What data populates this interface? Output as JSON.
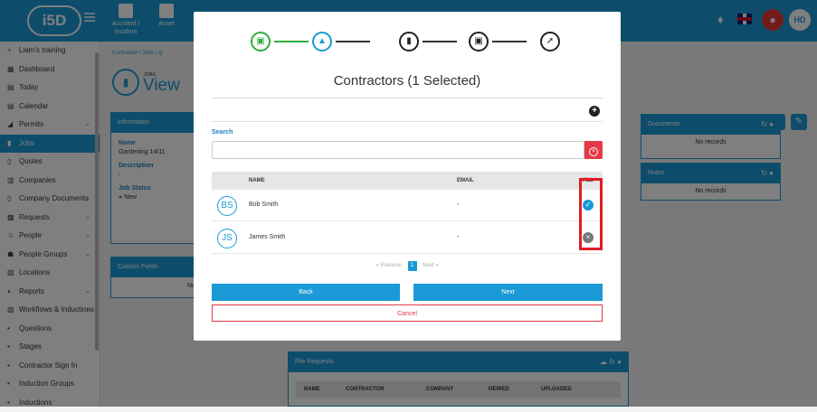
{
  "topbar": {
    "logo": "i5D",
    "nav": [
      {
        "label": "Accident / Incident"
      },
      {
        "label": "Asset"
      }
    ],
    "avatar_initials": "HD"
  },
  "sidebar": {
    "items": [
      {
        "label": "Liam's training",
        "icon": "branch-icon"
      },
      {
        "label": "Dashboard",
        "icon": "grid-icon"
      },
      {
        "label": "Today",
        "icon": "calendar-icon"
      },
      {
        "label": "Calendar",
        "icon": "calendar-icon"
      },
      {
        "label": "Permits",
        "icon": "permit-icon",
        "chevron": true
      },
      {
        "label": "Jobs",
        "icon": "clipboard-icon",
        "active": true
      },
      {
        "label": "Quotes",
        "icon": "quote-icon"
      },
      {
        "label": "Companies",
        "icon": "building-icon"
      },
      {
        "label": "Company Documents",
        "icon": "doc-icon",
        "chevron": true
      },
      {
        "label": "Requests",
        "icon": "request-icon",
        "chevron": true
      },
      {
        "label": "People",
        "icon": "people-icon",
        "chevron": true
      },
      {
        "label": "People Groups",
        "icon": "group-icon",
        "chevron": true
      },
      {
        "label": "Locations",
        "icon": "map-icon"
      },
      {
        "label": "Reports",
        "icon": "report-icon",
        "chevron": true
      },
      {
        "label": "Workflows & Inductions",
        "icon": "workflow-icon",
        "chevron": true
      },
      {
        "label": "Questions",
        "sub": true
      },
      {
        "label": "Stages",
        "sub": true
      },
      {
        "label": "Contractor Sign In",
        "sub": true
      },
      {
        "label": "Induction Groups",
        "sub": true
      },
      {
        "label": "Inductions",
        "sub": true
      }
    ]
  },
  "main": {
    "breadcrumb": [
      "Contractor",
      "Jobs",
      "Q"
    ],
    "page_small": "JOBS",
    "page_title": "View",
    "info_panel": {
      "title": "Information",
      "name_label": "Name",
      "name_value": "Gardening 14/11",
      "desc_label": "Description",
      "desc_value": "-",
      "status_label": "Job Status",
      "status_value": "New"
    },
    "custom_fields": {
      "title": "Custom Fields",
      "body": "No re"
    },
    "documents": {
      "title": "Documents",
      "body": "No records"
    },
    "notes": {
      "title": "Notes",
      "body": "No records"
    },
    "file_requests": {
      "title": "File Requests",
      "columns": [
        "NAME",
        "CONTRACTOR",
        "COMPANY",
        "VIEWED",
        "UPLOADED"
      ]
    }
  },
  "modal": {
    "title": "Contractors (1 Selected)",
    "search": {
      "label": "Search",
      "value": "",
      "placeholder": ""
    },
    "columns": {
      "name": "NAME",
      "email": "EMAIL",
      "all": "ALL"
    },
    "rows": [
      {
        "initials": "BS",
        "name": "Bob Smith",
        "email": "-",
        "selected": true
      },
      {
        "initials": "JS",
        "name": "James Smith",
        "email": "-",
        "selected": false
      }
    ],
    "pager": {
      "previous": "« Previous",
      "page": "1",
      "next": "Next »"
    },
    "buttons": {
      "back": "Back",
      "next": "Next",
      "cancel": "Cancel"
    }
  },
  "colors": {
    "primary": "#1a9ad6",
    "danger": "#e53945",
    "success": "#2eae3a",
    "highlight": "#e31b23"
  }
}
